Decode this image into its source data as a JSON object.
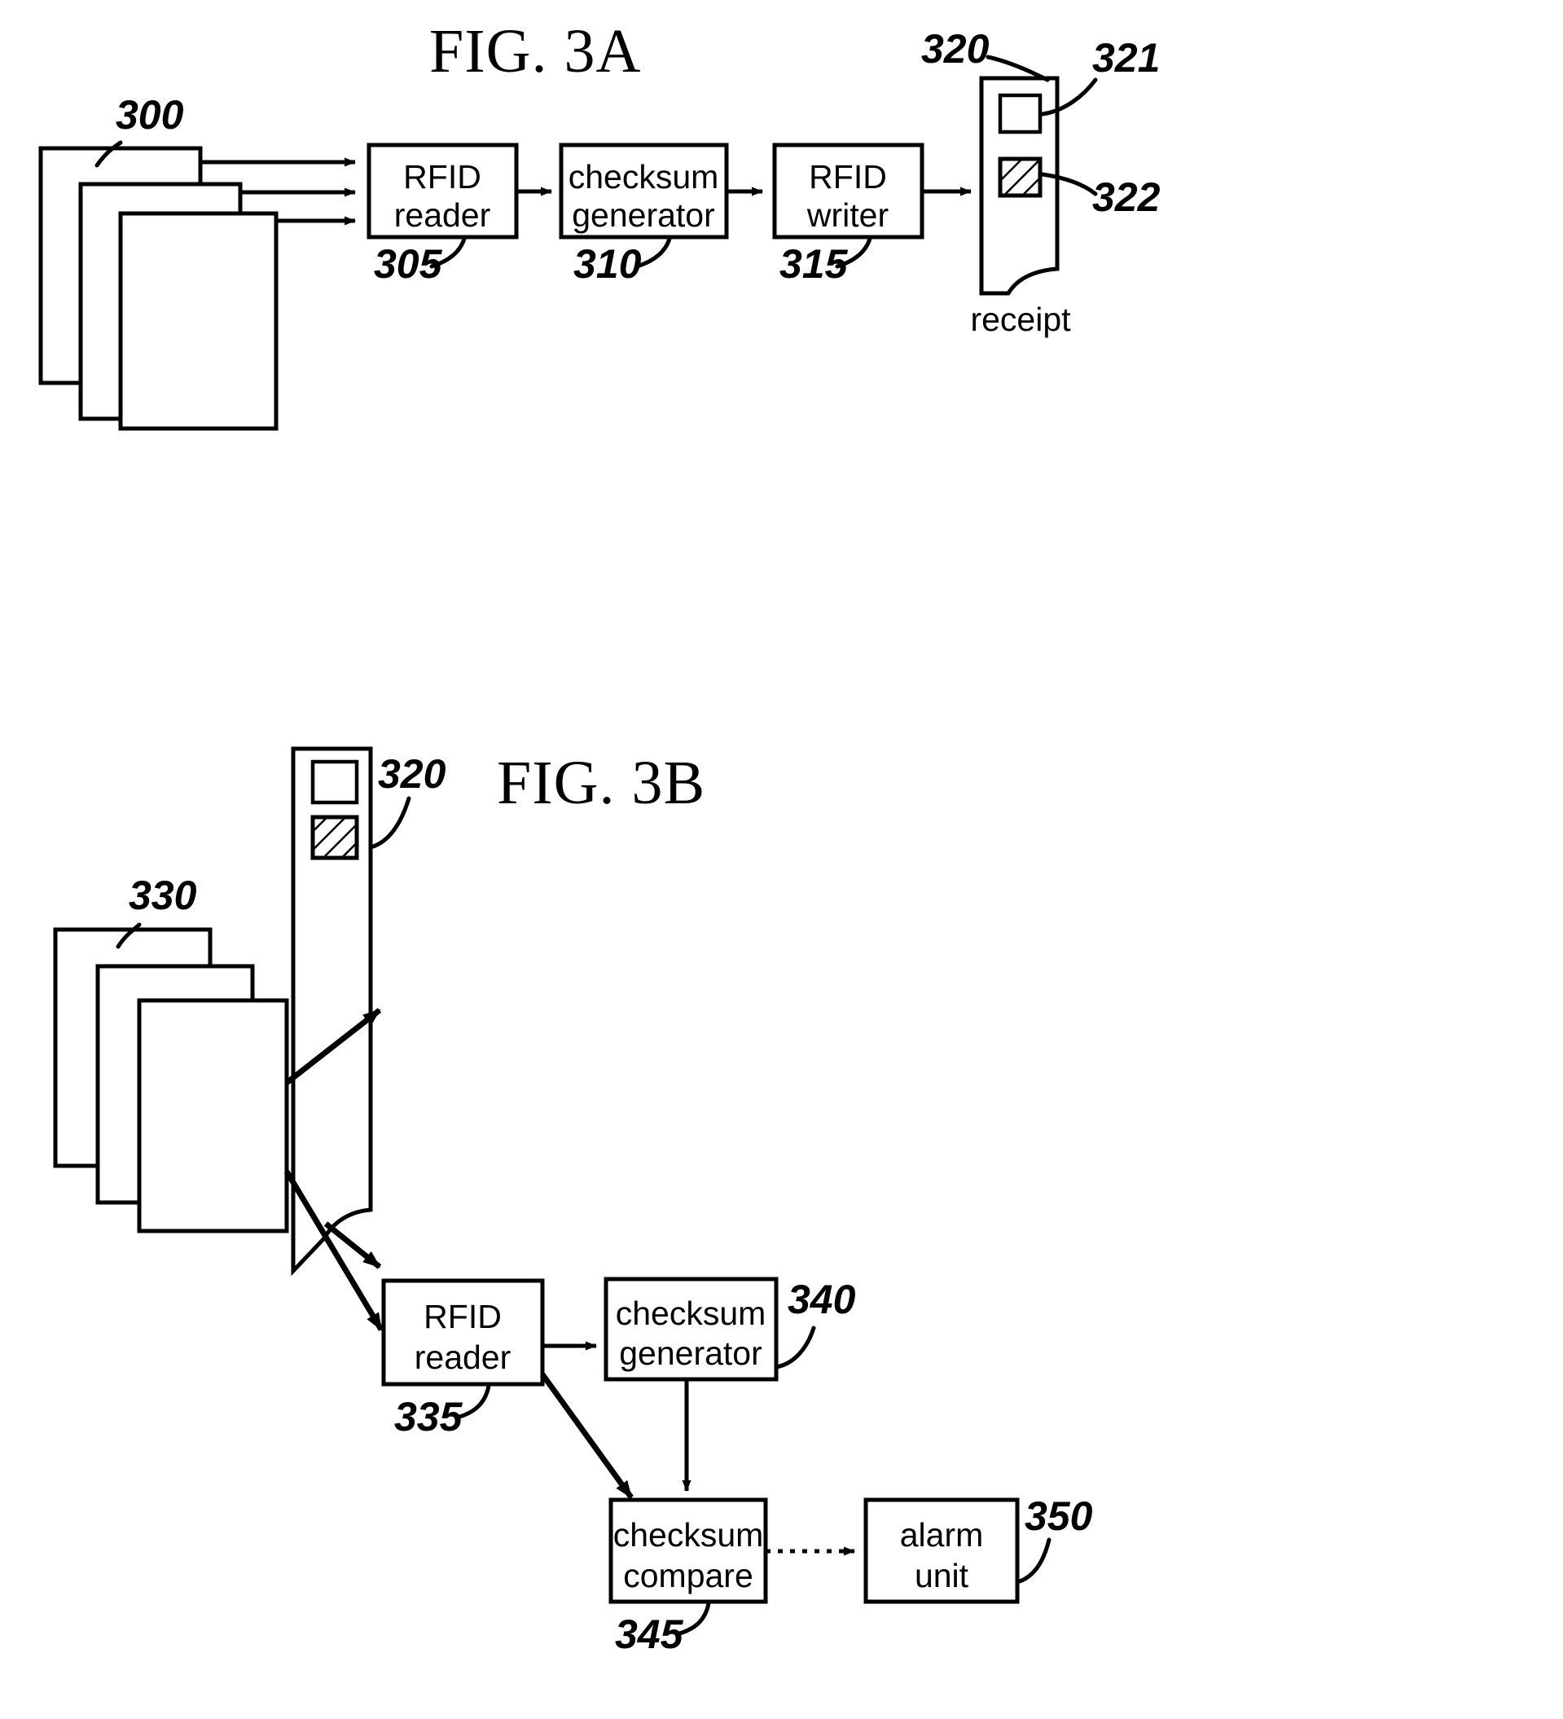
{
  "figures": [
    {
      "id": "fig-3a",
      "title": "FIG. 3A",
      "documents": {
        "ref": "300",
        "count": 3
      },
      "blocks": [
        {
          "ref": "305",
          "line1": "RFID",
          "line2": "reader"
        },
        {
          "ref": "310",
          "line1": "checksum",
          "line2": "generator"
        },
        {
          "ref": "315",
          "line1": "RFID",
          "line2": "writer"
        }
      ],
      "receipt": {
        "ref": "320",
        "caption": "receipt",
        "tags": [
          {
            "ref": "321",
            "style": "plain"
          },
          {
            "ref": "322",
            "style": "hatched"
          }
        ]
      }
    },
    {
      "id": "fig-3b",
      "title": "FIG. 3B",
      "documents": {
        "ref": "330",
        "count": 3
      },
      "receipt": {
        "ref": "320",
        "tags": [
          {
            "style": "plain"
          },
          {
            "style": "hatched"
          }
        ]
      },
      "blocks": [
        {
          "ref": "335",
          "line1": "RFID",
          "line2": "reader"
        },
        {
          "ref": "340",
          "line1": "checksum",
          "line2": "generator"
        },
        {
          "ref": "345",
          "line1": "checksum",
          "line2": "compare"
        },
        {
          "ref": "350",
          "line1": "alarm",
          "line2": "unit"
        }
      ]
    }
  ],
  "colors": {
    "ink": "#000000",
    "paper": "#ffffff"
  }
}
